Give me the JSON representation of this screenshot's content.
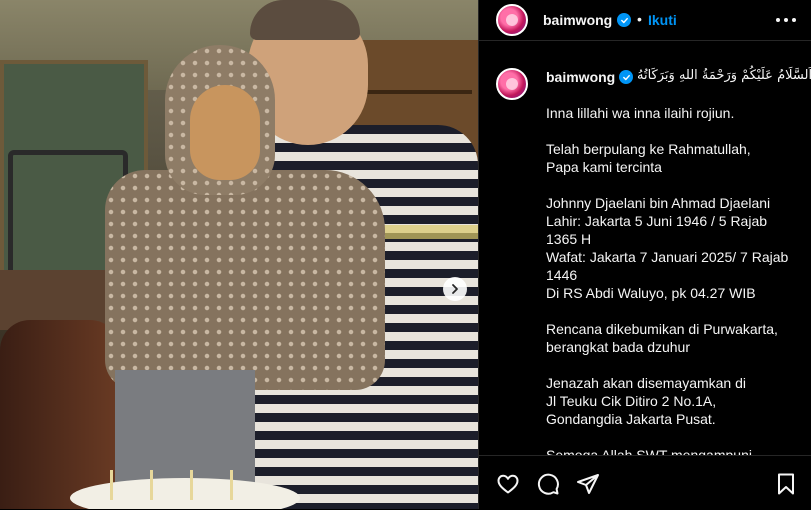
{
  "post": {
    "username": "baimwong",
    "separator": "•",
    "follow_label": "Ikuti"
  },
  "caption": {
    "username": "baimwong",
    "greeting": "اَلسَّلَامُ عَلَيْكُمْ وَرَحْمَةُ اللهِ وَبَرَكَاتُهُ",
    "lines": [
      "Inna lillahi wa inna ilaihi rojiun.",
      "Telah berpulang ke Rahmatullah,\nPapa kami tercinta",
      "Johnny Djaelani bin Ahmad Djaelani\nLahir: Jakarta 5 Juni 1946 / 5 Rajab 1365 H\nWafat: Jakarta 7 Januari 2025/ 7 Rajab 1446\nDi RS Abdi Waluyo, pk 04.27 WIB",
      "Rencana dikebumikan di Purwakarta,\nberangkat bada dzuhur",
      "Jenazah akan disemayamkan di\nJl Teuku Cik Ditiro 2 No.1A,\nGondangdia Jakarta Pusat.",
      "Semoga Allah SWT mengampuni"
    ]
  },
  "icons": {
    "verified": "verified-badge-icon",
    "more": "more-options-icon",
    "next": "chevron-right-icon",
    "like": "heart-icon",
    "comment": "comment-bubble-icon",
    "share": "send-paper-plane-icon",
    "save": "bookmark-icon"
  },
  "colors": {
    "background": "#000000",
    "text": "#f5f5f5",
    "accent": "#0095f6",
    "divider": "#262626"
  }
}
